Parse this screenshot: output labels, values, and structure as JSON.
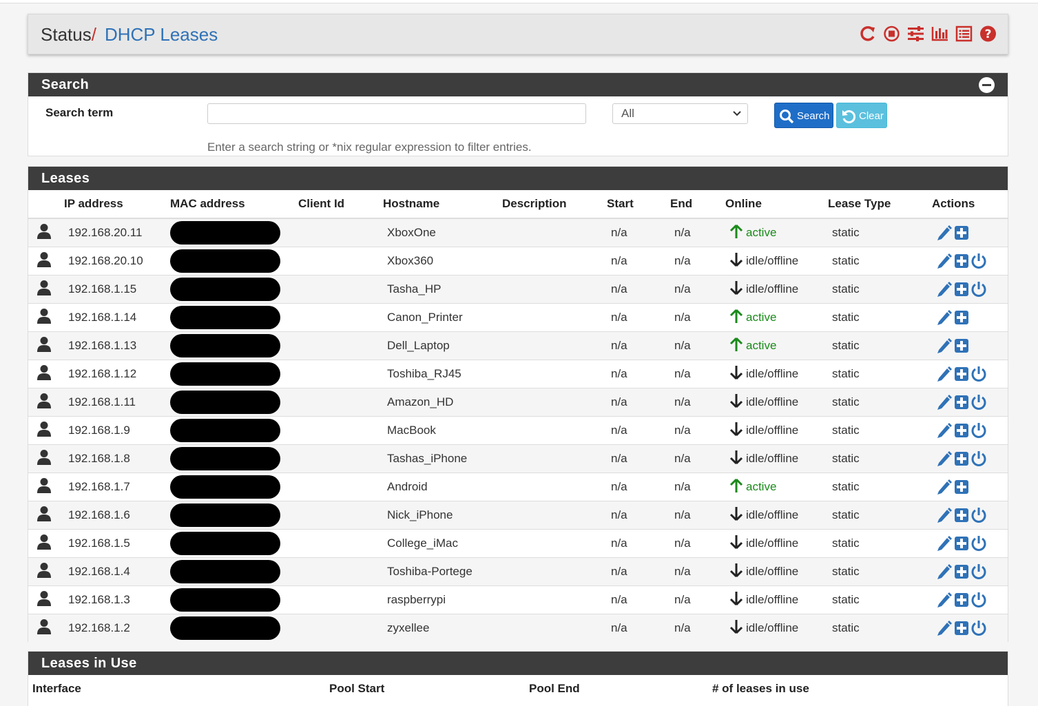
{
  "breadcrumb": {
    "parent": "Status",
    "separator": "/",
    "current": "DHCP Leases"
  },
  "colors": {
    "accent": "#2f72b7",
    "danger": "#c9302c",
    "panel_header": "#3d3d3d",
    "active": "#1a8a1a"
  },
  "search": {
    "title": "Search",
    "term_label": "Search term",
    "input_value": "",
    "select_value": "All",
    "search_label": "Search",
    "clear_label": "Clear",
    "help": "Enter a search string or *nix regular expression to filter entries."
  },
  "leases": {
    "title": "Leases",
    "columns": [
      "IP address",
      "MAC address",
      "Client Id",
      "Hostname",
      "Description",
      "Start",
      "End",
      "Online",
      "Lease Type",
      "Actions"
    ],
    "rows": [
      {
        "ip": "192.168.20.11",
        "hostname": "XboxOne",
        "start": "n/a",
        "end": "n/a",
        "online": "active",
        "type": "static"
      },
      {
        "ip": "192.168.20.10",
        "hostname": "Xbox360",
        "start": "n/a",
        "end": "n/a",
        "online": "idle/offline",
        "type": "static"
      },
      {
        "ip": "192.168.1.15",
        "hostname": "Tasha_HP",
        "start": "n/a",
        "end": "n/a",
        "online": "idle/offline",
        "type": "static"
      },
      {
        "ip": "192.168.1.14",
        "hostname": "Canon_Printer",
        "start": "n/a",
        "end": "n/a",
        "online": "active",
        "type": "static"
      },
      {
        "ip": "192.168.1.13",
        "hostname": "Dell_Laptop",
        "start": "n/a",
        "end": "n/a",
        "online": "active",
        "type": "static"
      },
      {
        "ip": "192.168.1.12",
        "hostname": "Toshiba_RJ45",
        "start": "n/a",
        "end": "n/a",
        "online": "idle/offline",
        "type": "static"
      },
      {
        "ip": "192.168.1.11",
        "hostname": "Amazon_HD",
        "start": "n/a",
        "end": "n/a",
        "online": "idle/offline",
        "type": "static"
      },
      {
        "ip": "192.168.1.9",
        "hostname": "MacBook",
        "start": "n/a",
        "end": "n/a",
        "online": "idle/offline",
        "type": "static"
      },
      {
        "ip": "192.168.1.8",
        "hostname": "Tashas_iPhone",
        "start": "n/a",
        "end": "n/a",
        "online": "idle/offline",
        "type": "static"
      },
      {
        "ip": "192.168.1.7",
        "hostname": "Android",
        "start": "n/a",
        "end": "n/a",
        "online": "active",
        "type": "static"
      },
      {
        "ip": "192.168.1.6",
        "hostname": "Nick_iPhone",
        "start": "n/a",
        "end": "n/a",
        "online": "idle/offline",
        "type": "static"
      },
      {
        "ip": "192.168.1.5",
        "hostname": "College_iMac",
        "start": "n/a",
        "end": "n/a",
        "online": "idle/offline",
        "type": "static"
      },
      {
        "ip": "192.168.1.4",
        "hostname": "Toshiba-Portege",
        "start": "n/a",
        "end": "n/a",
        "online": "idle/offline",
        "type": "static"
      },
      {
        "ip": "192.168.1.3",
        "hostname": "raspberrypi",
        "start": "n/a",
        "end": "n/a",
        "online": "idle/offline",
        "type": "static"
      },
      {
        "ip": "192.168.1.2",
        "hostname": "zyxellee",
        "start": "n/a",
        "end": "n/a",
        "online": "idle/offline",
        "type": "static"
      }
    ]
  },
  "in_use": {
    "title": "Leases in Use",
    "columns": [
      "Interface",
      "Pool Start",
      "Pool End",
      "# of leases in use"
    ]
  }
}
